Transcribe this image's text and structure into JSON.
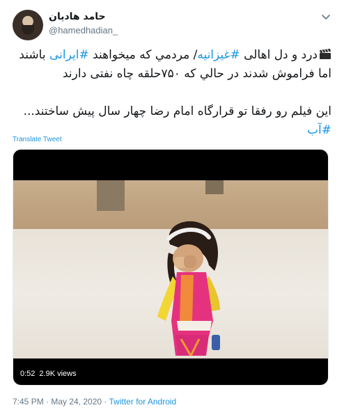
{
  "author": {
    "name": "حامد هادیان",
    "handle": "@hamedhadian_"
  },
  "tweet": {
    "paragraph1": {
      "part1": "درد و دل اهالی ",
      "hashtag1": "#غیزانیه",
      "part2": "/ مردمي که میخواهند ",
      "hashtag2": "#ایرانی",
      "part3": " باشند اما فراموش شدند در حالي که ۷۵۰حلقه چاه نفتی دارند"
    },
    "paragraph2": {
      "part1": "این فیلم رو رفقا تو قرارگاه امام رضا چهار سال پیش ساختند...",
      "hashtag": "#آب"
    },
    "translate_label": "Translate Tweet"
  },
  "video": {
    "duration": "0:52",
    "views": "2.9K views"
  },
  "meta": {
    "time": "7:45 PM · May 24, 2020 · ",
    "source": "Twitter for Android"
  },
  "colors": {
    "link": "#1b95e0",
    "text": "#14171a",
    "secondary": "#657786"
  },
  "icons": {
    "menu": "chevron-down-icon",
    "emoji": "clapper-board-icon"
  }
}
